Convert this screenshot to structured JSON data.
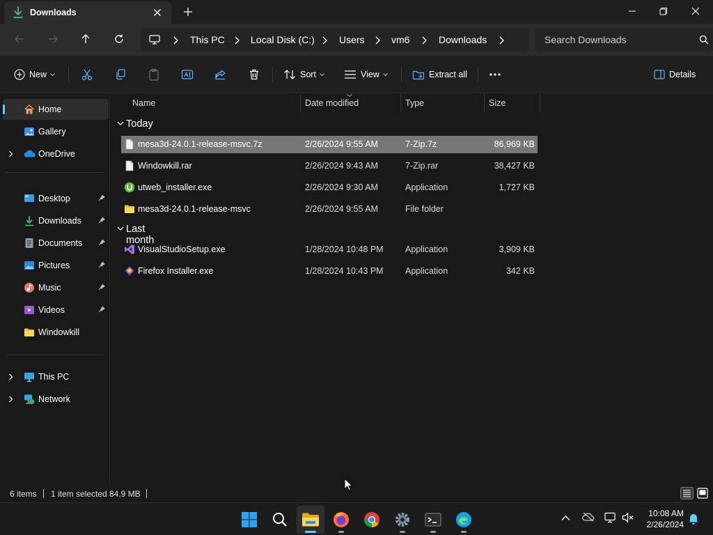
{
  "window": {
    "tab_title": "Downloads",
    "icons": {
      "tab": "download-icon",
      "close": "close-icon",
      "new_tab": "plus-icon"
    }
  },
  "navigation": {
    "icons": [
      "back-arrow-icon",
      "forward-arrow-icon",
      "up-arrow-icon",
      "refresh-icon"
    ]
  },
  "address": {
    "crumbs": [
      "This PC",
      "Local Disk (C:)",
      "Users",
      "vm6",
      "Downloads"
    ]
  },
  "search": {
    "placeholder": "Search Downloads"
  },
  "toolbar": {
    "new_label": "New",
    "sort_label": "Sort",
    "view_label": "View",
    "extract_label": "Extract all",
    "details_label": "Details"
  },
  "sidebar": {
    "items": [
      {
        "label": "Home",
        "icon": "home-icon",
        "active": true
      },
      {
        "label": "Gallery",
        "icon": "gallery-icon"
      },
      {
        "label": "OneDrive",
        "icon": "cloud-icon",
        "expandable": true
      },
      {
        "label": "Desktop",
        "icon": "desktop-icon",
        "pinned": true
      },
      {
        "label": "Downloads",
        "icon": "download-icon",
        "pinned": true
      },
      {
        "label": "Documents",
        "icon": "document-icon",
        "pinned": true
      },
      {
        "label": "Pictures",
        "icon": "pictures-icon",
        "pinned": true
      },
      {
        "label": "Music",
        "icon": "music-icon",
        "pinned": true
      },
      {
        "label": "Videos",
        "icon": "video-icon",
        "pinned": true
      },
      {
        "label": "Windowkill",
        "icon": "folder-icon"
      },
      {
        "label": "This PC",
        "icon": "computer-icon",
        "expandable": true
      },
      {
        "label": "Network",
        "icon": "network-icon",
        "expandable": true
      }
    ]
  },
  "columns": {
    "name": "Name",
    "date": "Date modified",
    "type": "Type",
    "size": "Size"
  },
  "groups": [
    {
      "label": "Today",
      "files": [
        {
          "name": "mesa3d-24.0.1-release-msvc.7z",
          "date": "2/26/2024 9:55 AM",
          "type": "7-Zip.7z",
          "size": "86,969 KB",
          "selected": true,
          "icon": "file-icon"
        },
        {
          "name": "Windowkill.rar",
          "date": "2/26/2024 9:43 AM",
          "type": "7-Zip.rar",
          "size": "38,427 KB",
          "icon": "file-icon"
        },
        {
          "name": "utweb_installer.exe",
          "date": "2/26/2024 9:30 AM",
          "type": "Application",
          "size": "1,727 KB",
          "icon": "utorrent-icon"
        },
        {
          "name": "mesa3d-24.0.1-release-msvc",
          "date": "2/26/2024 9:55 AM",
          "type": "File folder",
          "size": "",
          "icon": "folder-icon"
        }
      ]
    },
    {
      "label": "Last month",
      "files": [
        {
          "name": "VisualStudioSetup.exe",
          "date": "1/28/2024 10:48 PM",
          "type": "Application",
          "size": "3,909 KB",
          "icon": "visual-studio-icon"
        },
        {
          "name": "Firefox Installer.exe",
          "date": "1/28/2024 10:43 PM",
          "type": "Application",
          "size": "342 KB",
          "icon": "firefox-installer-icon"
        }
      ]
    }
  ],
  "status": {
    "items": "6 items",
    "selection": "1 item selected",
    "size": "84.9 MB"
  },
  "taskbar": {
    "apps": [
      "start-icon",
      "search-icon",
      "file-explorer-icon",
      "firefox-icon",
      "chrome-icon",
      "settings-icon",
      "terminal-icon",
      "edge-icon"
    ],
    "tray": [
      "chevron-up-icon",
      "onedrive-icon",
      "network-icon",
      "volume-mute-icon",
      "notification-icon"
    ],
    "time": "10:08 AM",
    "date": "2/26/2024"
  },
  "colors": {
    "accent": "#60cdff",
    "selected_row": "#777777",
    "folder": "#f3c13a"
  }
}
